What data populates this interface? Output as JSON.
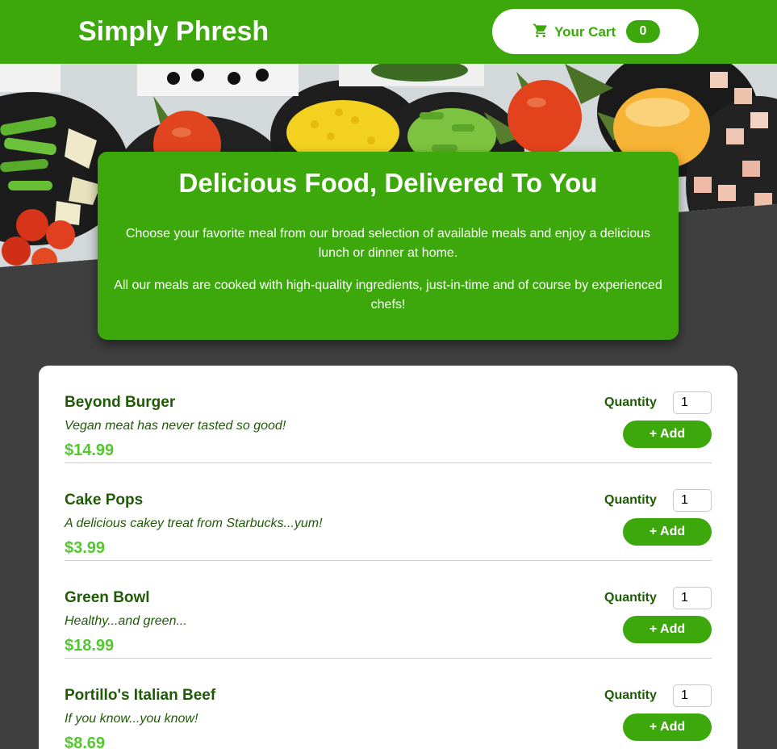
{
  "header": {
    "brand": "Simply Phresh",
    "cart_label": "Your Cart",
    "cart_count": "0",
    "cart_icon": "shopping-cart-icon"
  },
  "hero": {
    "title": "Delicious Food, Delivered To You",
    "paragraph1": "Choose your favorite meal from our broad selection of available meals and enjoy a delicious lunch or dinner at home.",
    "paragraph2": "All our meals are cooked with high-quality ingredients, just-in-time and of course by experienced chefs!"
  },
  "meals": [
    {
      "name": "Beyond Burger",
      "description": "Vegan meat has never tasted so good!",
      "price": "$14.99",
      "quantity_label": "Quantity",
      "quantity": "1",
      "add_label": "+ Add"
    },
    {
      "name": "Cake Pops",
      "description": "A delicious cakey treat from Starbucks...yum!",
      "price": "$3.99",
      "quantity_label": "Quantity",
      "quantity": "1",
      "add_label": "+ Add"
    },
    {
      "name": "Green Bowl",
      "description": "Healthy...and green...",
      "price": "$18.99",
      "quantity_label": "Quantity",
      "quantity": "1",
      "add_label": "+ Add"
    },
    {
      "name": "Portillo's Italian Beef",
      "description": "If you know...you know!",
      "price": "$8.69",
      "quantity_label": "Quantity",
      "quantity": "1",
      "add_label": "+ Add"
    }
  ],
  "colors": {
    "brand_green": "#3da80b",
    "dark_green_text": "#1f5b07",
    "price_green": "#52c82e",
    "page_background": "#3f3f3f"
  }
}
